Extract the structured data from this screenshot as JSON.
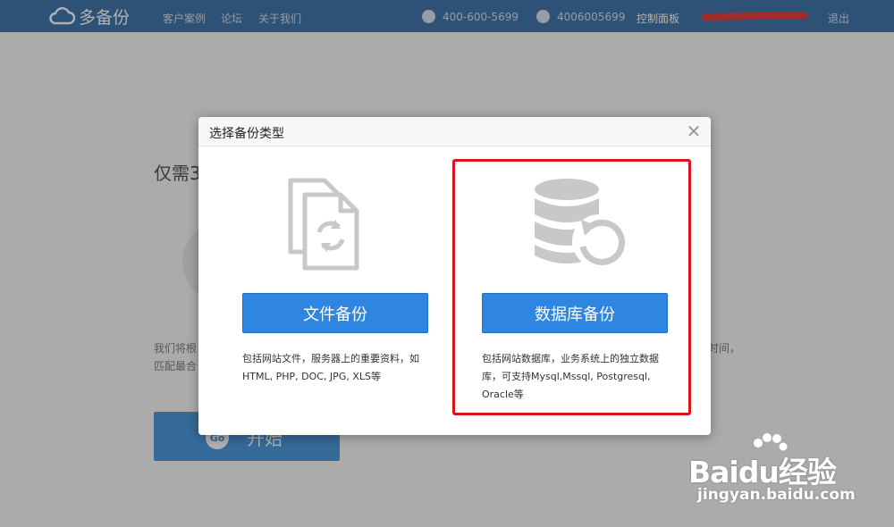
{
  "nav": {
    "logo_text": "多备份",
    "links": [
      "客户案例",
      "论坛",
      "关于我们"
    ],
    "phone": "400-600-5699",
    "qq": "4006005699",
    "control_panel": "控制面板",
    "logout": "退出"
  },
  "background": {
    "heading_partial": "仅需3",
    "desc_line1": "我们将根",
    "desc_line1_right": "时间，",
    "desc_line2": "匹配最合",
    "go_badge": "Go",
    "go_label": "开始"
  },
  "modal": {
    "title": "选择备份类型",
    "close_symbol": "✕",
    "options": [
      {
        "button": "文件备份",
        "description": "包括网站文件，服务器上的重要资料，如HTML, PHP, DOC, JPG, XLS等",
        "icon": "file-sync-icon"
      },
      {
        "button": "数据库备份",
        "description": "包括网站数据库，业务系统上的独立数据库，可支持Mysql,Mssql, Postgresql, Oracle等",
        "icon": "database-restore-icon"
      }
    ]
  },
  "watermark": {
    "brand": "Baidu经验",
    "url": "jingyan.baidu.com"
  },
  "colors": {
    "nav_bg": "#1e5a99",
    "primary_button": "#2e86e0",
    "highlight": "#d9141b",
    "icon_gray": "#c8c8c8"
  }
}
